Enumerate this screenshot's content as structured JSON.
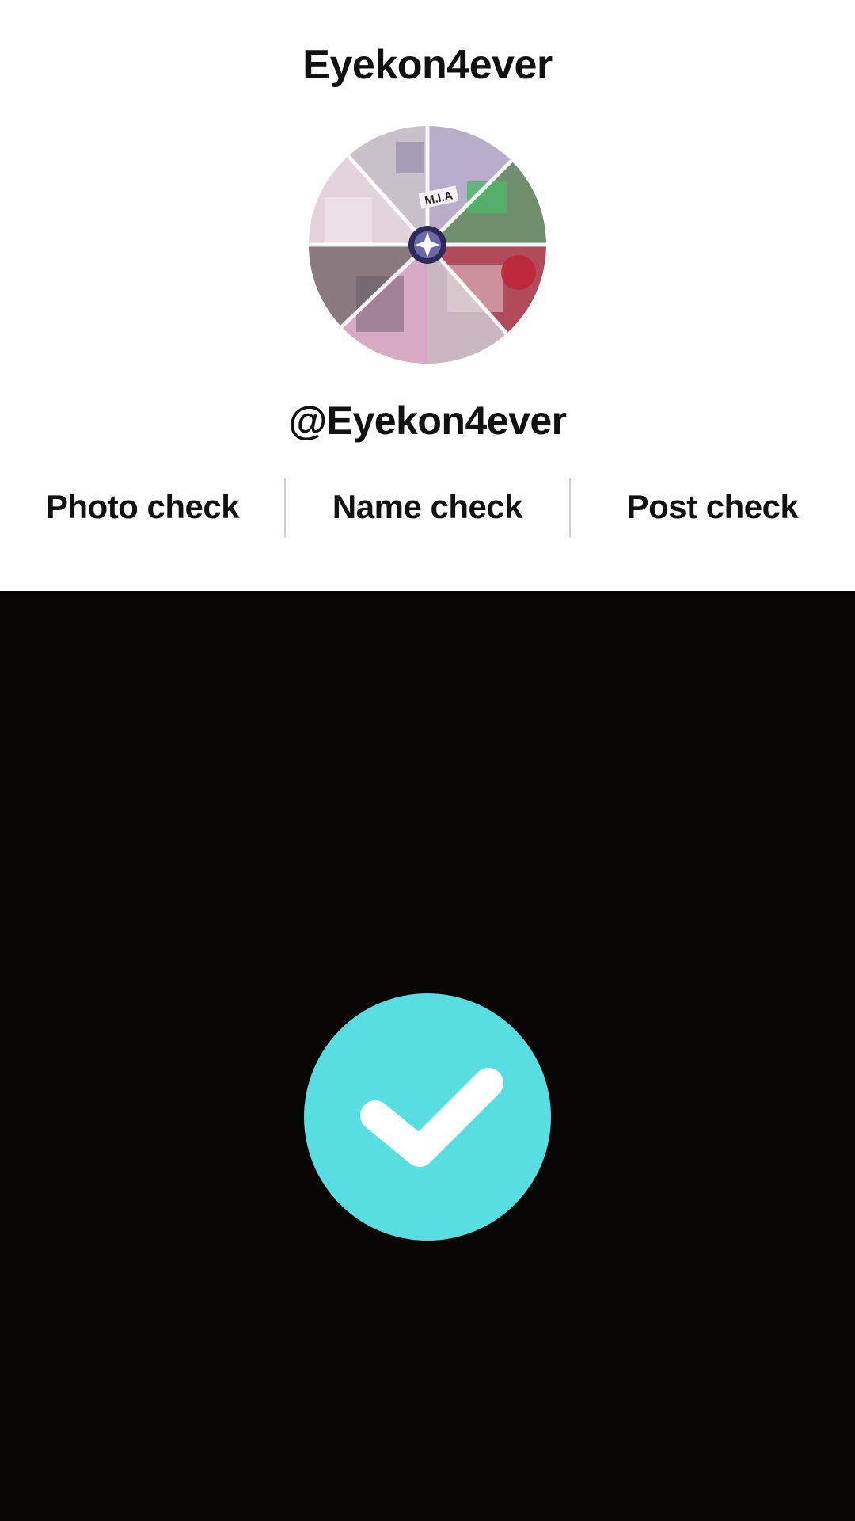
{
  "header": {
    "title": "Eyekon4ever"
  },
  "profile": {
    "handle": "@Eyekon4ever",
    "avatar_text": "M.I.A"
  },
  "checks": [
    {
      "label": "Photo check"
    },
    {
      "label": "Name check"
    },
    {
      "label": "Post check"
    }
  ],
  "status": {
    "icon": "checkmark-icon",
    "color": "#58dde0"
  }
}
